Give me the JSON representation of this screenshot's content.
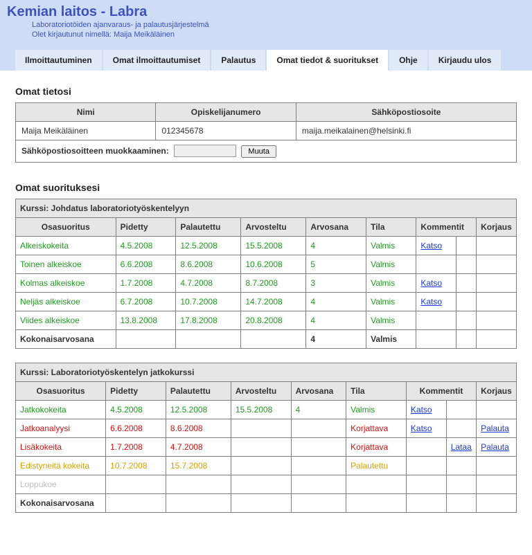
{
  "header": {
    "title": "Kemian laitos - Labra",
    "subtitle1": "Laboratoriotöiden ajanvaraus- ja palautusjärjestelmä",
    "subtitle2": "Olet kirjautunut nimellä: Maija Meikäläinen"
  },
  "tabs": {
    "t0": "Ilmoittautuminen",
    "t1": "Omat ilmoittautumiset",
    "t2": "Palautus",
    "t3": "Omat tiedot & suoritukset",
    "t4": "Ohje",
    "t5": "Kirjaudu ulos"
  },
  "info": {
    "section": "Omat tietosi",
    "h_name": "Nimi",
    "h_num": "Opiskelijanumero",
    "h_email": "Sähköpostiosoite",
    "name": "Maija Meikäläinen",
    "num": "012345678",
    "email": "maija.meikalainen@helsinki.fi",
    "edit_label": "Sähköpostiosoitteen muokkaaminen:",
    "edit_btn": "Muuta"
  },
  "courses": {
    "section": "Omat suorituksesi",
    "h_osa": "Osasuoritus",
    "h_pid": "Pidetty",
    "h_pal": "Palautettu",
    "h_arv": "Arvosteltu",
    "h_arvs": "Arvosana",
    "h_tila": "Tila",
    "h_kom": "Kommentit",
    "h_kor": "Korjaus",
    "total_label": "Kokonaisarvosana",
    "link_katso": "Katso",
    "link_lataa": "Lataa",
    "link_palauta": "Palauta",
    "c1": {
      "title": "Kurssi: Johdatus laboratoriotyöskentelyyn",
      "r0": {
        "osa": "Alkeiskokeita",
        "pid": "4.5.2008",
        "pal": "12.5.2008",
        "arv": "15.5.2008",
        "arvs": "4",
        "tila": "Valmis",
        "kom": "Katso"
      },
      "r1": {
        "osa": "Toinen alkeiskoe",
        "pid": "6.6.2008",
        "pal": "8.6.2008",
        "arv": "10.6.2008",
        "arvs": "5",
        "tila": "Valmis",
        "kom": ""
      },
      "r2": {
        "osa": "Kolmas alkeiskoe",
        "pid": "1.7.2008",
        "pal": "4.7.2008",
        "arv": "8.7.2008",
        "arvs": "3",
        "tila": "Valmis",
        "kom": "Katso"
      },
      "r3": {
        "osa": "Neljäs alkeiskoe",
        "pid": "6.7.2008",
        "pal": "10.7.2008",
        "arv": "14.7.2008",
        "arvs": "4",
        "tila": "Valmis",
        "kom": "Katso"
      },
      "r4": {
        "osa": "Viides alkeiskoe",
        "pid": "13.8.2008",
        "pal": "17.8.2008",
        "arv": "20.8.2008",
        "arvs": "4",
        "tila": "Valmis",
        "kom": ""
      },
      "total_arvs": "4",
      "total_tila": "Valmis"
    },
    "c2": {
      "title": "Kurssi: Laboratoriotyöskentelyn jatkokurssi",
      "r0": {
        "osa": "Jatkokokeita",
        "pid": "4.5.2008",
        "pal": "12.5.2008",
        "arv": "15.5.2008",
        "arvs": "4",
        "tila": "Valmis",
        "kom": "Katso",
        "kor": ""
      },
      "r1": {
        "osa": "Jatkoanalyysi",
        "pid": "6.6.2008",
        "pal": "8.6.2008",
        "arv": "",
        "arvs": "",
        "tila": "Korjattava",
        "kom": "Katso",
        "kor": "Palauta"
      },
      "r2": {
        "osa": "Lisäkokeita",
        "pid": "1.7.2008",
        "pal": "4.7.2008",
        "arv": "",
        "arvs": "",
        "tila": "Korjattava",
        "kom": "Lataa",
        "kor": "Palauta"
      },
      "r3": {
        "osa": "Edistyneitä kokeita",
        "pid": "10.7.2008",
        "pal": "15.7.2008",
        "arv": "",
        "arvs": "",
        "tila": "Palautettu",
        "kom": "",
        "kor": ""
      },
      "r4": {
        "osa": "Loppukoe",
        "pid": "",
        "pal": "",
        "arv": "",
        "arvs": "",
        "tila": "",
        "kom": "",
        "kor": ""
      }
    }
  }
}
